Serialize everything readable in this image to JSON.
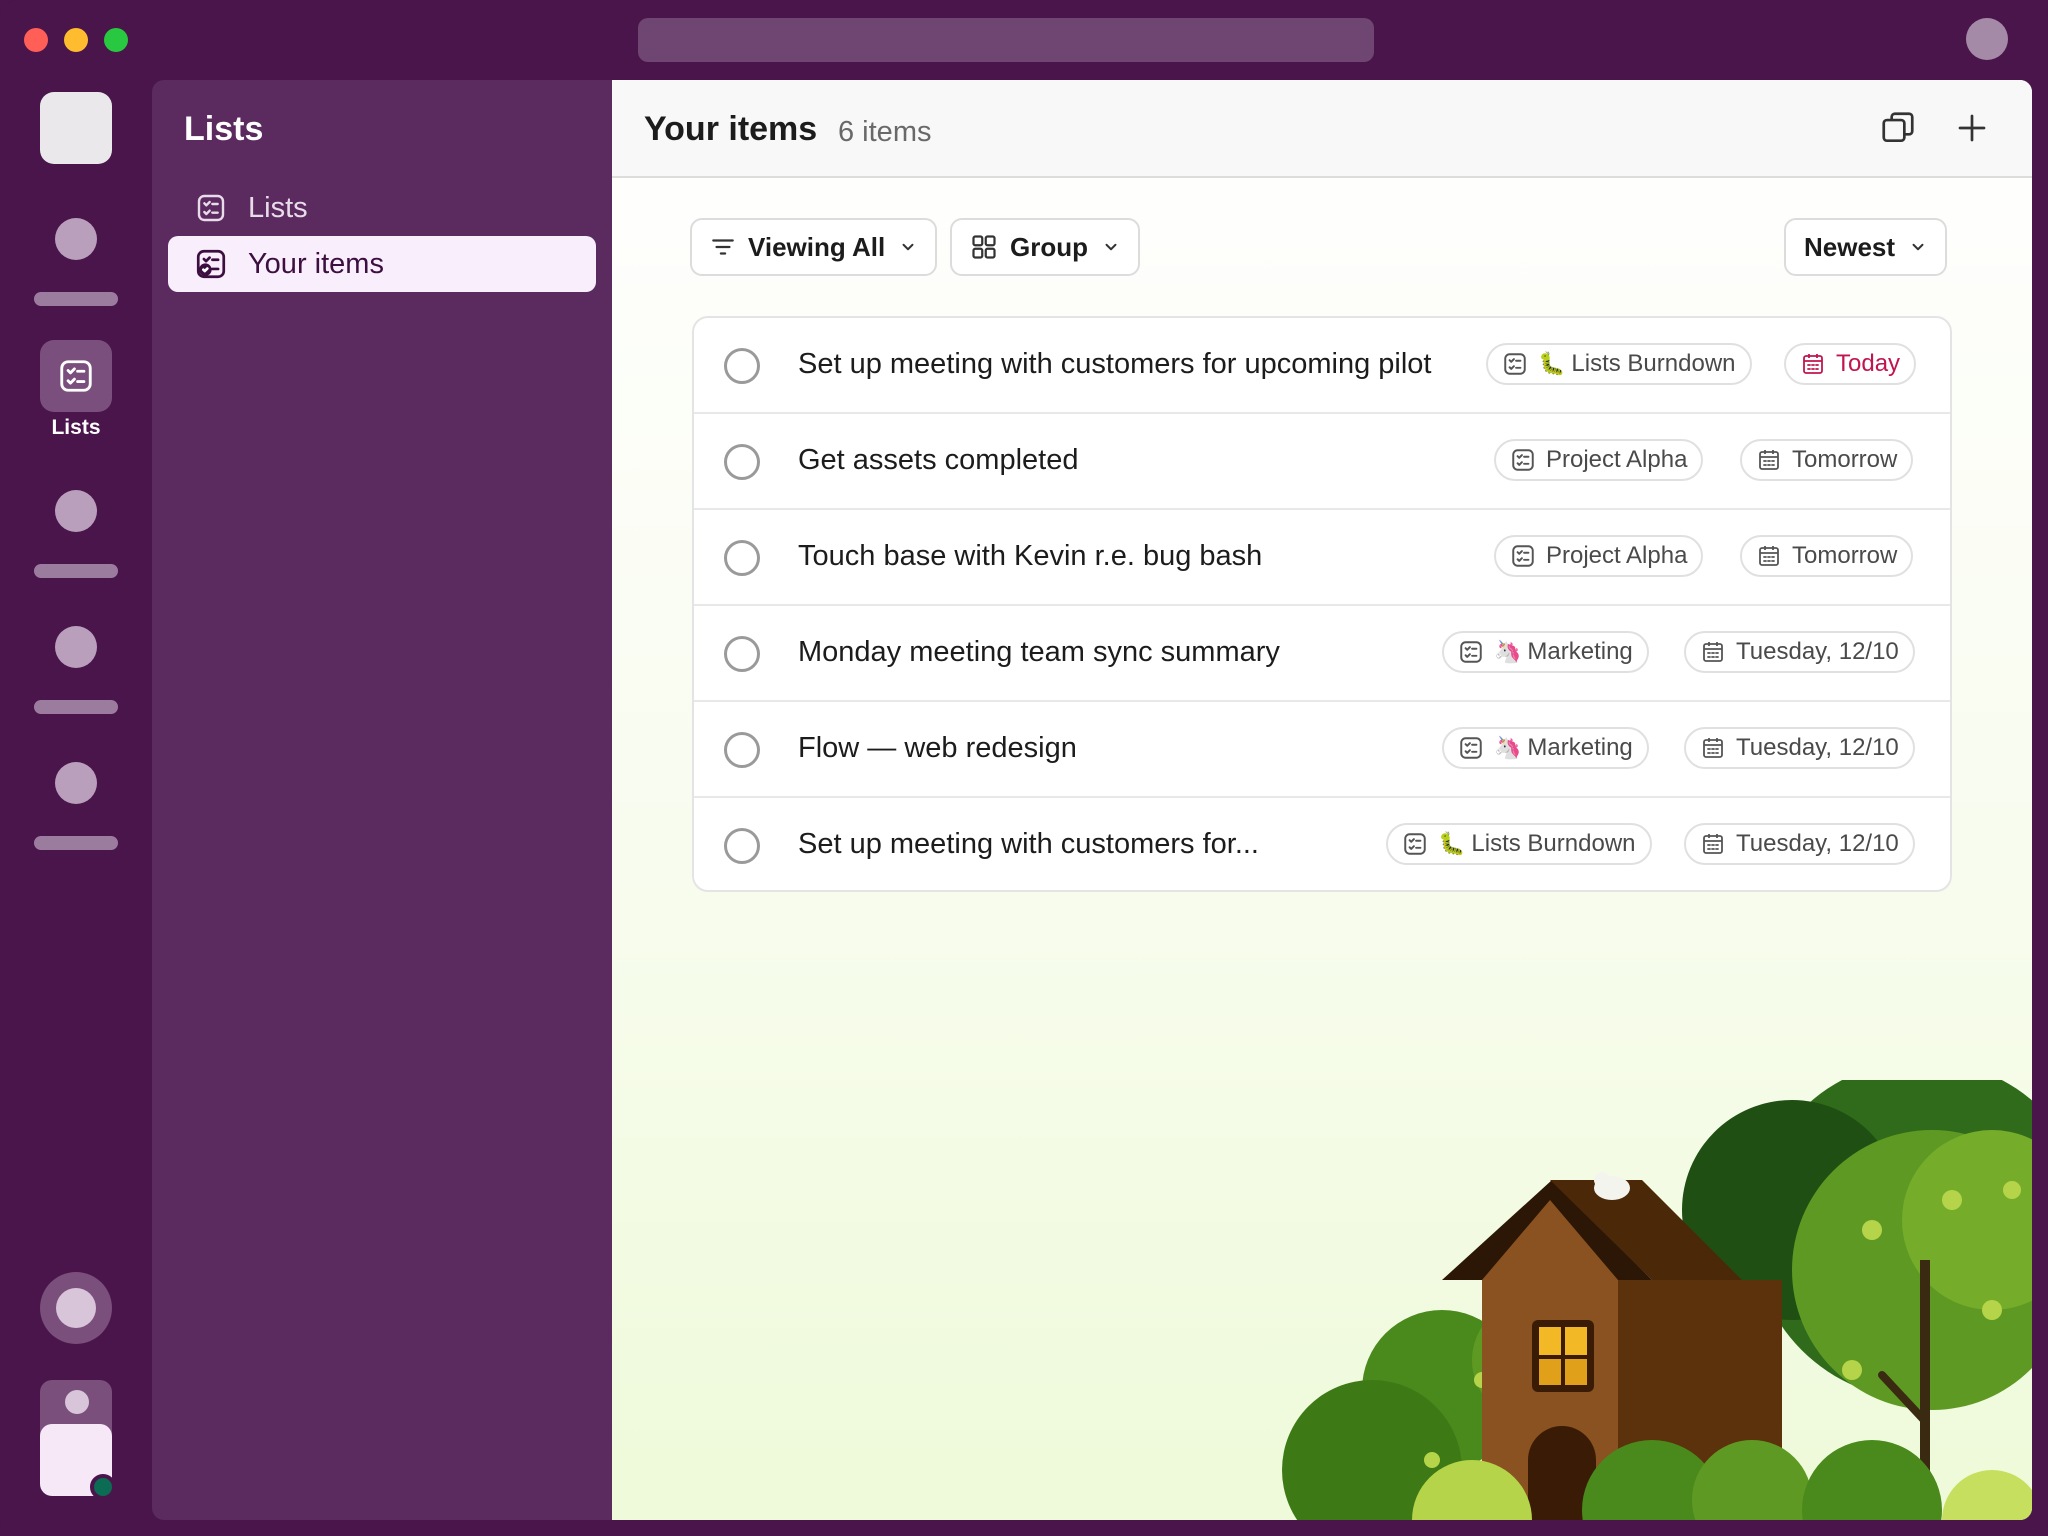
{
  "rail": {
    "lists_label": "Lists"
  },
  "sidebar": {
    "title": "Lists",
    "items": [
      {
        "label": "Lists",
        "icon": "checklist-icon"
      },
      {
        "label": "Your items",
        "icon": "my-items-icon",
        "active": true
      }
    ]
  },
  "main": {
    "title": "Your items",
    "count": "6 items",
    "filters": {
      "viewing": "Viewing All",
      "group": "Group",
      "sort": "Newest"
    },
    "items": [
      {
        "title": "Set up meeting with customers for upcoming pilot",
        "list_emoji": "🐛",
        "list": "Lists Burndown",
        "due": "Today",
        "due_color": "#c0164e"
      },
      {
        "title": "Get assets completed",
        "list_emoji": "",
        "list": "Project Alpha",
        "due": "Tomorrow"
      },
      {
        "title": "Touch base with Kevin r.e. bug bash",
        "list_emoji": "",
        "list": "Project Alpha",
        "due": "Tomorrow"
      },
      {
        "title": "Monday meeting team sync summary",
        "list_emoji": "🦄",
        "list": "Marketing",
        "due": "Tuesday, 12/10"
      },
      {
        "title": "Flow — web redesign",
        "list_emoji": "🦄",
        "list": "Marketing",
        "due": "Tuesday, 12/10"
      },
      {
        "title": "Set up meeting with customers for...",
        "list_emoji": "🐛",
        "list": "Lists Burndown",
        "due": "Tuesday, 12/10"
      }
    ]
  },
  "colors": {
    "aubergine": "#4a154b",
    "sidebar": "#5b2a5e",
    "accent_today": "#c0164e"
  }
}
